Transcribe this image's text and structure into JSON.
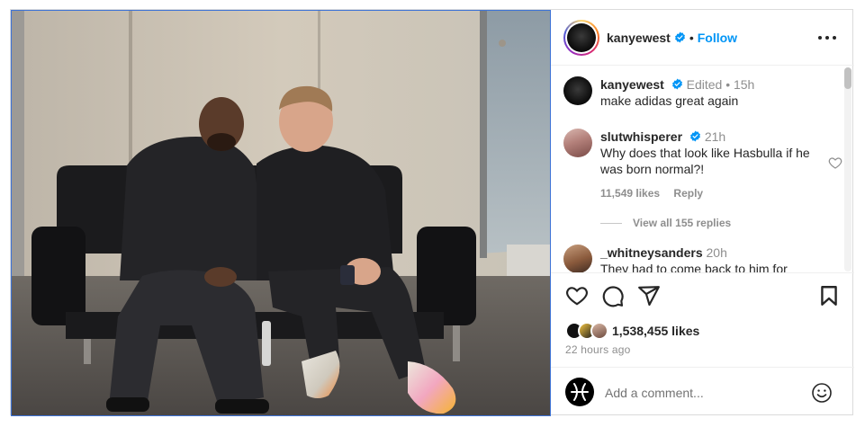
{
  "post_author": {
    "username": "kanyewest",
    "follow_label": "Follow",
    "separator": "•"
  },
  "comments": [
    {
      "username": "kanyewest",
      "meta": "Edited • 15h",
      "text": "make adidas great again"
    },
    {
      "username": "slutwhisperer",
      "meta": "21h",
      "text": "Why does that look like Hasbulla if he was born normal?!",
      "likes": "11,549 likes",
      "reply_label": "Reply",
      "view_replies": "View all 155 replies"
    },
    {
      "username": "_whitneysanders",
      "meta": "20h",
      "text": "They had to come back to him for"
    }
  ],
  "engagement": {
    "likes": "1,538,455 likes",
    "posted": "22 hours ago"
  },
  "add_comment": {
    "placeholder": "Add a comment..."
  },
  "icons": {
    "verified": "verified-badge-icon",
    "more": "more-options-icon",
    "like": "heart-icon",
    "comment": "comment-icon",
    "share": "share-icon",
    "save": "bookmark-icon",
    "emoji": "emoji-icon"
  },
  "colors": {
    "accent": "#0095f6",
    "text": "#262626",
    "muted": "#8e8e8e"
  }
}
